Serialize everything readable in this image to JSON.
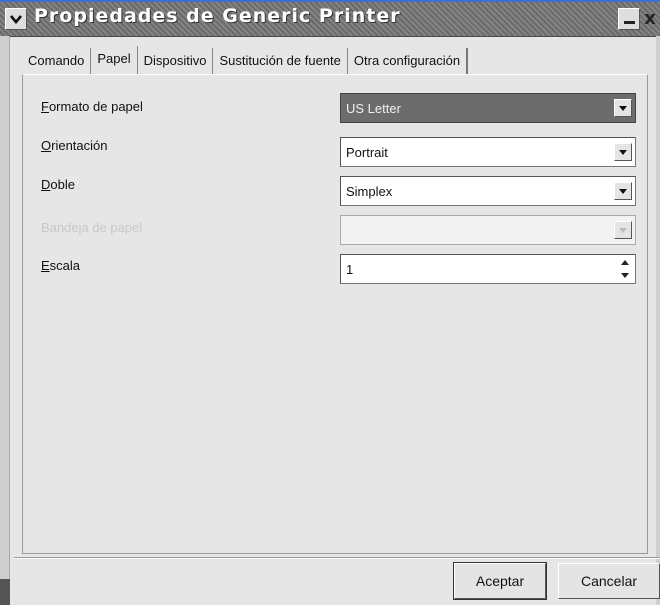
{
  "window": {
    "title": "Propiedades de Generic Printer",
    "menu_icon": "chevron-down-icon",
    "minimize_icon": "minimize-icon",
    "close_glyph": "x",
    "close_icon": "close-icon"
  },
  "tabs": [
    {
      "label": "Comando",
      "active": false
    },
    {
      "label": "Papel",
      "active": true
    },
    {
      "label": "Dispositivo",
      "active": false
    },
    {
      "label": "Sustitución de fuente",
      "active": false
    },
    {
      "label": "Otra configuración",
      "active": false
    }
  ],
  "form": {
    "paper_format": {
      "label_first": "F",
      "label_rest": "ormato de papel",
      "value": "US Letter",
      "selected": true
    },
    "orientation": {
      "label_first": "O",
      "label_rest": "rientación",
      "value": "Portrait"
    },
    "duplex": {
      "label_first": "D",
      "label_rest": "oble",
      "value": "Simplex"
    },
    "paper_tray": {
      "label": "Bandeja de papel",
      "value": "",
      "disabled": true
    },
    "scale": {
      "label_first": "E",
      "label_rest": "scala",
      "value": "1"
    }
  },
  "buttons": {
    "ok_label": "Aceptar",
    "cancel_label": "Cancelar"
  },
  "colors": {
    "titlebar": "#767676",
    "accent": "#3b6fd0",
    "window_bg": "#e6e6e6",
    "selected_field": "#6c6c6c"
  }
}
